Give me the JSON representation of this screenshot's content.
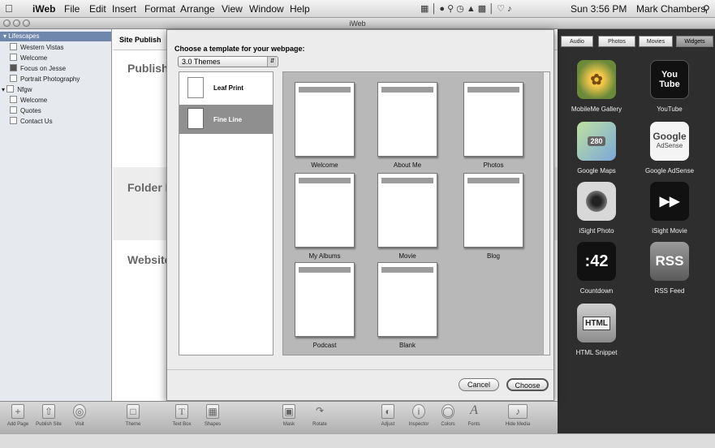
{
  "menubar": {
    "apple": "",
    "app_name": "iWeb",
    "menus": [
      "File",
      "Edit",
      "Insert",
      "Format",
      "Arrange",
      "View",
      "Window",
      "Help"
    ],
    "clock": "Sun 3:56 PM",
    "user": "Mark Chambers"
  },
  "window": {
    "title": "iWeb"
  },
  "sidebar": {
    "site1": "Lifescapes",
    "site1_pages": [
      "Western Vistas",
      "Welcome",
      "Focus on Jesse",
      "Portrait Photography"
    ],
    "site2": "Nfgw",
    "site2_pages": [
      "Welcome",
      "Quotes",
      "Contact Us"
    ]
  },
  "main": {
    "tab": "Site Publish",
    "publish_heading": "Publish",
    "folder_heading": "Folder L",
    "website_heading": "Website"
  },
  "template_sheet": {
    "prompt": "Choose a template for your webpage:",
    "theme_select": "3.0 Themes",
    "themes": [
      "Leaf Print",
      "Fine Line"
    ],
    "selected_theme": "Fine Line",
    "templates": [
      "Welcome",
      "About Me",
      "Photos",
      "My Albums",
      "Movie",
      "Blog",
      "Podcast",
      "Blank"
    ],
    "cancel": "Cancel",
    "choose": "Choose"
  },
  "inspector": {
    "tabs": [
      "Audio",
      "Photos",
      "Movies",
      "Widgets"
    ],
    "active_tab": "Widgets",
    "widgets": [
      {
        "label": "MobileMe Gallery",
        "icon": "sunflower-icon"
      },
      {
        "label": "YouTube",
        "icon": "youtube-icon",
        "text": "You Tube"
      },
      {
        "label": "Google Maps",
        "icon": "map-icon",
        "text": "280"
      },
      {
        "label": "Google AdSense",
        "icon": "adsense-icon",
        "text": "Google",
        "sub": "AdSense"
      },
      {
        "label": "iSight Photo",
        "icon": "camera-icon"
      },
      {
        "label": "iSight Movie",
        "icon": "clapboard-icon"
      },
      {
        "label": "Countdown",
        "icon": "countdown-icon",
        "text": ":42"
      },
      {
        "label": "RSS Feed",
        "icon": "rss-icon",
        "text": "RSS"
      },
      {
        "label": "HTML Snippet",
        "icon": "html-icon",
        "text": "HTML"
      }
    ]
  },
  "toolbar": {
    "buttons": [
      "Add Page",
      "Publish Site",
      "Visit",
      "Theme",
      "Text Box",
      "Shapes",
      "Mask",
      "Rotate",
      "Adjust",
      "Inspector",
      "Colors",
      "Fonts",
      "Hide Media"
    ]
  },
  "colors": {
    "sheet_bg": "#ececec",
    "selected_theme": "#8f8f8f",
    "inspector_bg": "#2e2e2e"
  }
}
